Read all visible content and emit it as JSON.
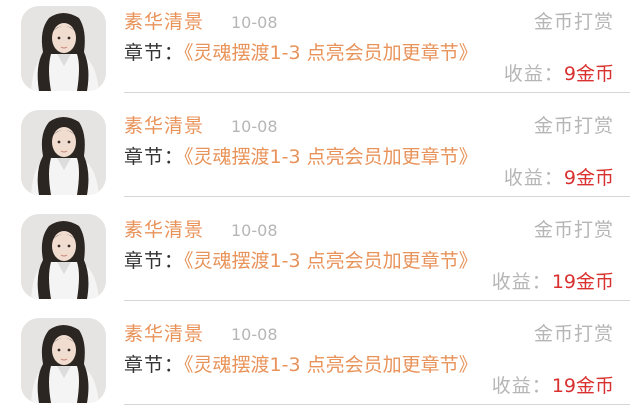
{
  "records": [
    {
      "user": "素华清景",
      "date": "10-08",
      "type": "金币打赏",
      "chapter_label": "章节：",
      "chapter_title": "《灵魂摆渡1-3 点亮会员加更章节》",
      "income_label": "收益：",
      "income_amount": "9金币"
    },
    {
      "user": "素华清景",
      "date": "10-08",
      "type": "金币打赏",
      "chapter_label": "章节：",
      "chapter_title": "《灵魂摆渡1-3 点亮会员加更章节》",
      "income_label": "收益：",
      "income_amount": "9金币"
    },
    {
      "user": "素华清景",
      "date": "10-08",
      "type": "金币打赏",
      "chapter_label": "章节：",
      "chapter_title": "《灵魂摆渡1-3 点亮会员加更章节》",
      "income_label": "收益：",
      "income_amount": "19金币"
    },
    {
      "user": "素华清景",
      "date": "10-08",
      "type": "金币打赏",
      "chapter_label": "章节：",
      "chapter_title": "《灵魂摆渡1-3 点亮会员加更章节》",
      "income_label": "收益：",
      "income_amount": "19金币"
    }
  ],
  "colors": {
    "accent": "#e8935a",
    "muted": "#b6b6b6",
    "income": "#d9312f",
    "text": "#333333"
  }
}
